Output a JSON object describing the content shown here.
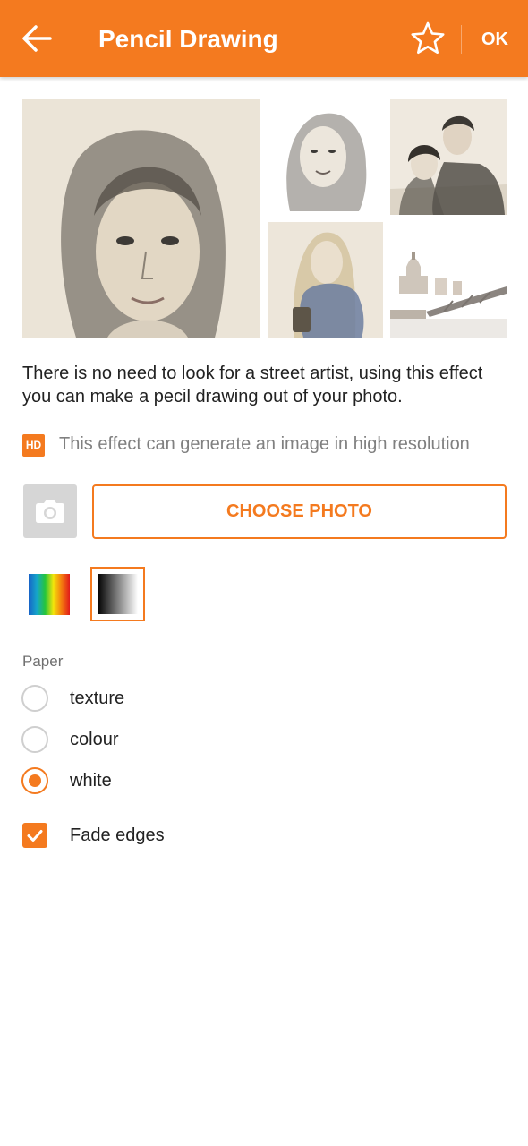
{
  "appbar": {
    "title": "Pencil Drawing",
    "ok_label": "OK",
    "background_color": "#f47a1f",
    "back_icon": "arrow-left-icon",
    "favorite_icon": "star-outline-icon"
  },
  "examples": [
    {
      "name": "woman-portrait-sketch"
    },
    {
      "name": "girl-portrait-sketch"
    },
    {
      "name": "couple-sketch"
    },
    {
      "name": "woman-scarf-sketch"
    },
    {
      "name": "city-cathedral-sketch"
    }
  ],
  "description": "There is no need to look for a street artist, using this effect you can make a pecil drawing out of your photo.",
  "hd": {
    "badge": "HD",
    "text": "This effect can generate an image in high resolution"
  },
  "actions": {
    "camera_icon": "camera-icon",
    "choose_photo_label": "CHOOSE PHOTO"
  },
  "color_modes": {
    "options": [
      "color",
      "black-and-white"
    ],
    "selected": "black-and-white"
  },
  "paper": {
    "label": "Paper",
    "options": [
      {
        "label": "texture",
        "checked": false
      },
      {
        "label": "colour",
        "checked": false
      },
      {
        "label": "white",
        "checked": true
      }
    ]
  },
  "fade_edges": {
    "label": "Fade edges",
    "checked": true
  },
  "accent_color": "#f47a1f"
}
